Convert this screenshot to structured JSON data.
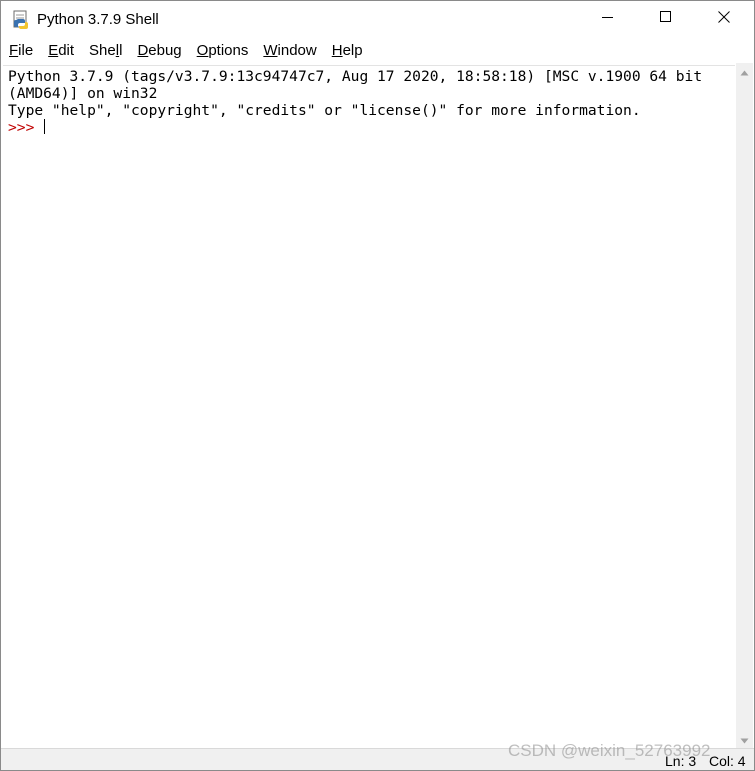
{
  "window": {
    "title": "Python 3.7.9 Shell"
  },
  "menu": {
    "items": [
      {
        "ul": "F",
        "rest": "ile"
      },
      {
        "ul": "E",
        "rest": "dit"
      },
      {
        "pre": "She",
        "ul": "l",
        "rest": "l"
      },
      {
        "ul": "D",
        "rest": "ebug"
      },
      {
        "ul": "O",
        "rest": "ptions"
      },
      {
        "ul": "W",
        "rest": "indow"
      },
      {
        "ul": "H",
        "rest": "elp"
      }
    ]
  },
  "shell": {
    "line1": "Python 3.7.9 (tags/v3.7.9:13c94747c7, Aug 17 2020, 18:58:18) [MSC v.1900 64 bit",
    "line2": "(AMD64)] on win32",
    "line3": "Type \"help\", \"copyright\", \"credits\" or \"license()\" for more information.",
    "prompt": ">>> "
  },
  "status": {
    "ln": "Ln: 3",
    "col": "Col: 4"
  },
  "watermark": "CSDN @weixin_52763992",
  "icons": {
    "app": "python-idle-icon",
    "minimize": "minimize-icon",
    "maximize": "maximize-icon",
    "close": "close-icon",
    "scroll_up": "scroll-up-arrow-icon",
    "scroll_down": "scroll-down-arrow-icon"
  },
  "colors": {
    "prompt": "#c00000",
    "scrollbar": "#f0f0f0",
    "statusbar": "#f0f0f0"
  }
}
